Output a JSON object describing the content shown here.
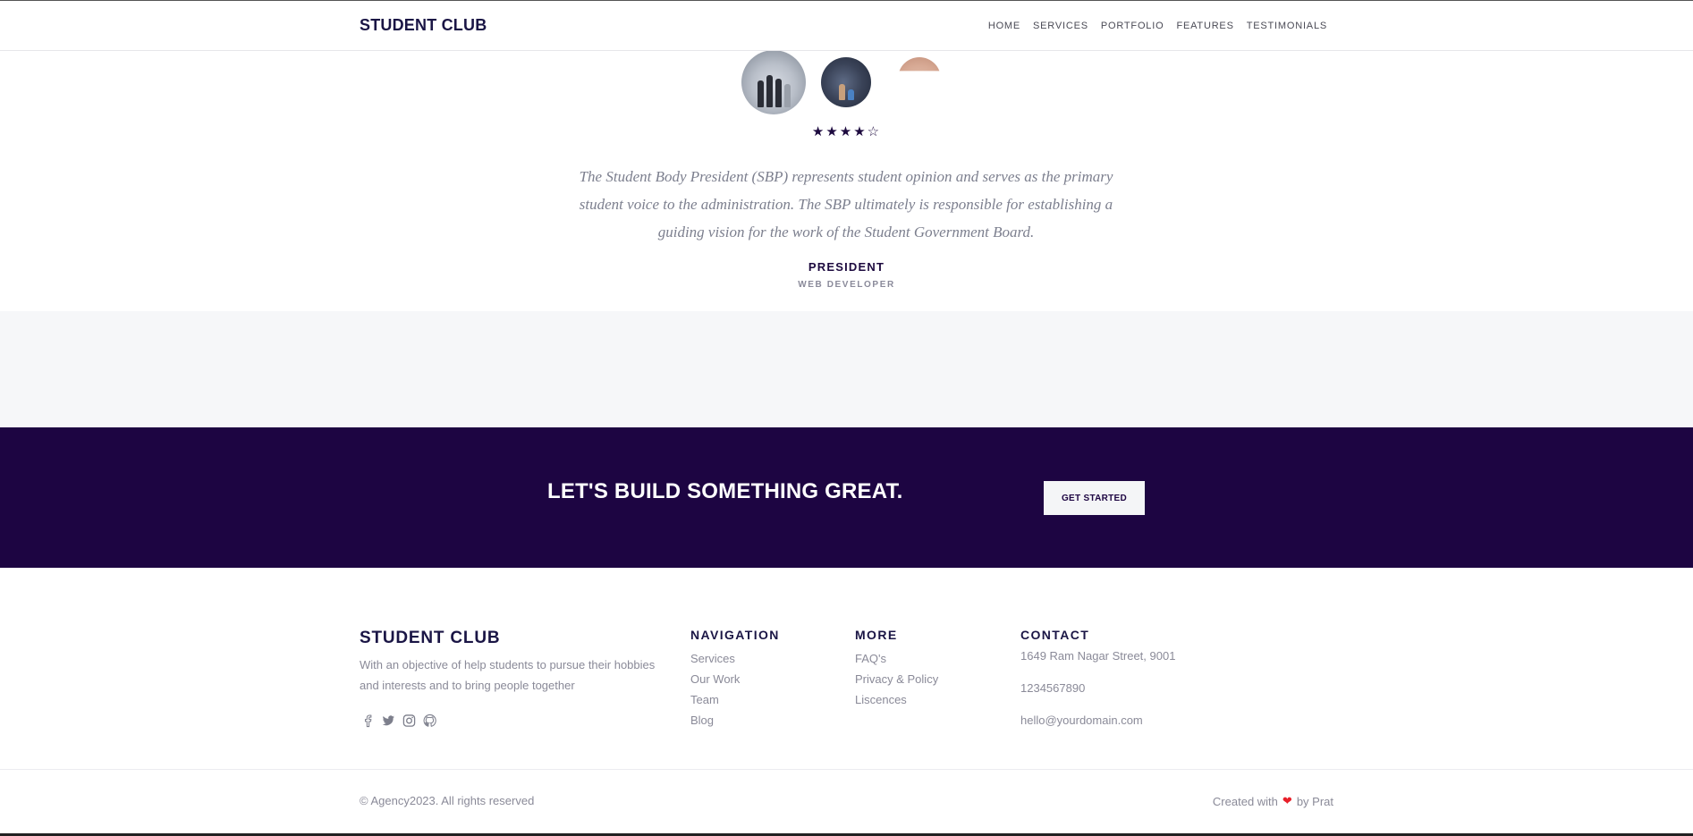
{
  "header": {
    "brand": "STUDENT CLUB",
    "nav": [
      "HOME",
      "SERVICES",
      "PORTFOLIO",
      "FEATURES",
      "TESTIMONIALS"
    ]
  },
  "testimonial": {
    "rating": "★★★★☆",
    "rating_value": 4,
    "rating_max": 5,
    "quote": "The Student Body President (SBP) represents student opinion and serves as the primary student voice to the administration. The SBP ultimately is responsible for establishing a guiding vision for the work of the Student Government Board.",
    "role": "PRESIDENT",
    "subrole": "WEB DEVELOPER"
  },
  "cta": {
    "title": "LET'S BUILD SOMETHING GREAT.",
    "button": "GET STARTED"
  },
  "footer": {
    "brand": "STUDENT CLUB",
    "description": "With an objective of help students to pursue their hobbies and interests and to bring people together",
    "social_icons": [
      "facebook-icon",
      "twitter-icon",
      "instagram-icon",
      "github-icon"
    ],
    "navigation": {
      "heading": "NAVIGATION",
      "links": [
        "Services",
        "Our Work",
        "Team",
        "Blog"
      ]
    },
    "more": {
      "heading": "MORE",
      "links": [
        "FAQ's",
        "Privacy & Policy",
        "Liscences"
      ]
    },
    "contact": {
      "heading": "CONTACT",
      "address": "1649 Ram Nagar Street, 9001",
      "phone": "1234567890",
      "email": "hello@yourdomain.com"
    },
    "copyright": "© Agency2023. All rights reserved",
    "credit_prefix": "Created with",
    "credit_suffix": "by Prat"
  },
  "colors": {
    "brand_dark": "#1d0542",
    "heart": "#e8202a",
    "muted_text": "#8a8a98"
  }
}
